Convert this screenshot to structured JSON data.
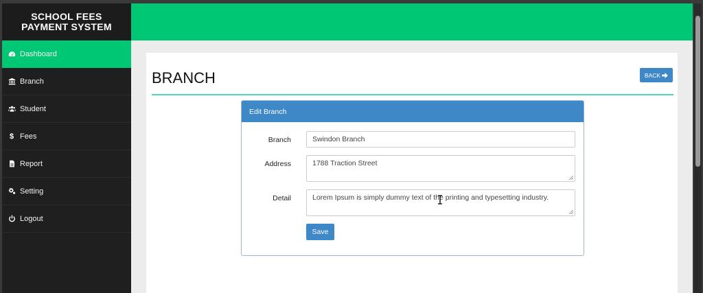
{
  "app": {
    "brand_line1": "SCHOOL FEES",
    "brand_line2": "PAYMENT SYSTEM",
    "accent_color": "#00c774",
    "primary_color": "#3f88c8"
  },
  "sidebar": {
    "items": [
      {
        "label": "Dashboard",
        "icon": "dashboard-icon",
        "active": true
      },
      {
        "label": "Branch",
        "icon": "bank-icon",
        "active": false
      },
      {
        "label": "Student",
        "icon": "users-icon",
        "active": false
      },
      {
        "label": "Fees",
        "icon": "dollar-icon",
        "active": false
      },
      {
        "label": "Report",
        "icon": "file-icon",
        "active": false
      },
      {
        "label": "Setting",
        "icon": "cogs-icon",
        "active": false
      },
      {
        "label": "Logout",
        "icon": "power-icon",
        "active": false
      }
    ]
  },
  "page": {
    "title": "BRANCH",
    "back_label": "BACK"
  },
  "form": {
    "heading": "Edit Branch",
    "branch_label": "Branch",
    "branch_value": "Swindon Branch",
    "address_label": "Address",
    "address_value": "1788 Traction Street",
    "detail_label": "Detail",
    "detail_value": "Lorem Ipsum is simply dummy text of the printing and typesetting industry.",
    "save_label": "Save"
  }
}
